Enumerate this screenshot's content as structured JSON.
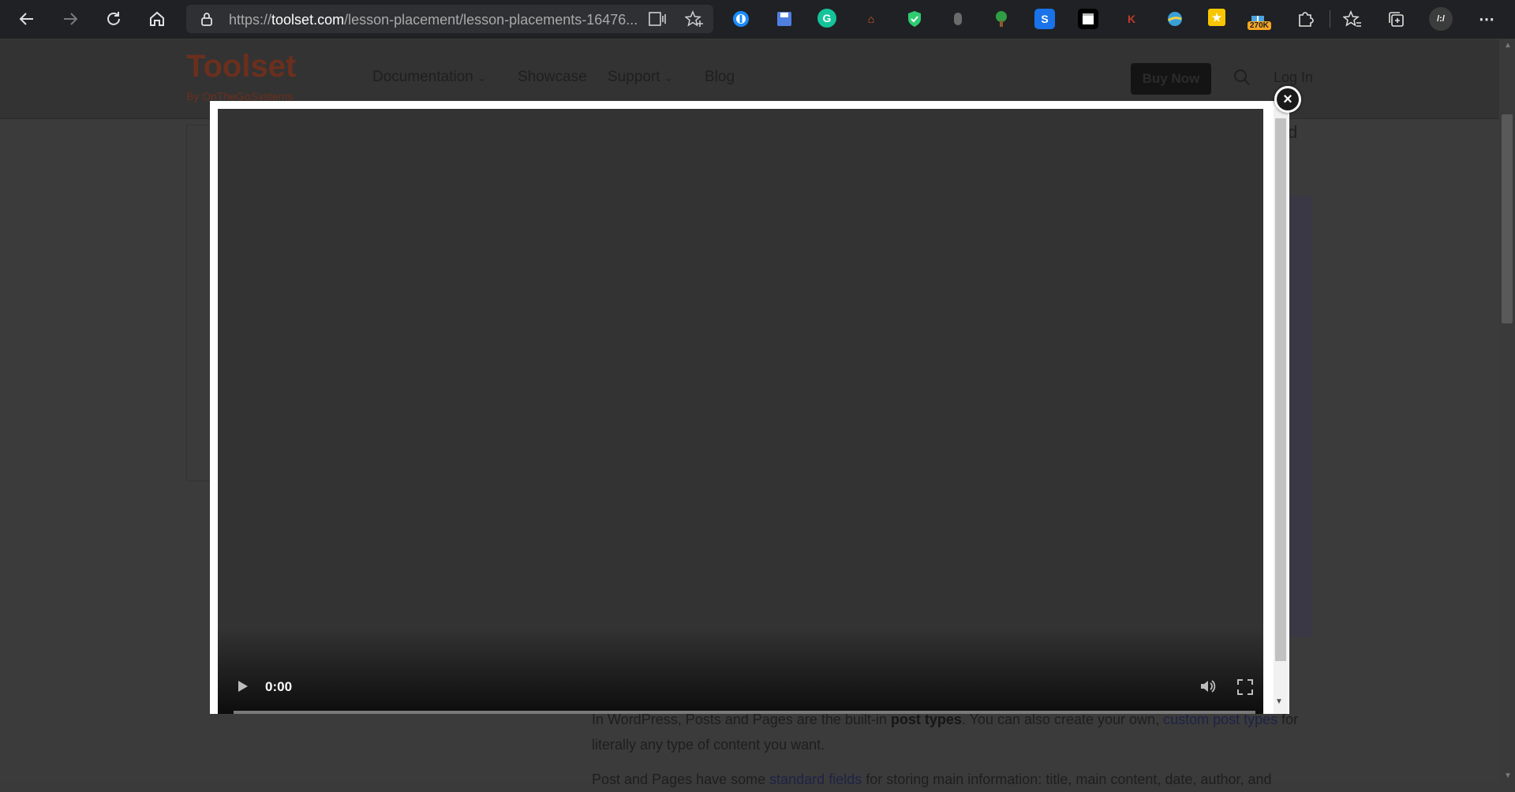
{
  "browser": {
    "url_prefix": "https://",
    "url_host": "toolset.com",
    "url_path": "/lesson-placement/lesson-placements-16476...",
    "extension_badge": "270K"
  },
  "site": {
    "logo": "Toolset",
    "logo_sub": "By OnTheGoSystems",
    "nav": {
      "documentation": "Documentation",
      "showcase": "Showcase",
      "support": "Support",
      "blog": "Blog"
    },
    "buy_now": "Buy Now",
    "login": "Log In",
    "partial_heading": "d",
    "paragraph": {
      "l1_a": "In WordPress, Posts and Pages are the built-in ",
      "l1_b": "post types",
      "l1_c": ". You can also create your own, ",
      "l1_d": "custom post types",
      "l1_e": " for",
      "l2": "literally any type of content you want.",
      "l3_a": "Post and Pages have some ",
      "l3_b": "standard fields",
      "l3_c": " for storing main information: title, main content, date, author, and"
    }
  },
  "video": {
    "time": "0:00",
    "close_symbol": "×"
  }
}
